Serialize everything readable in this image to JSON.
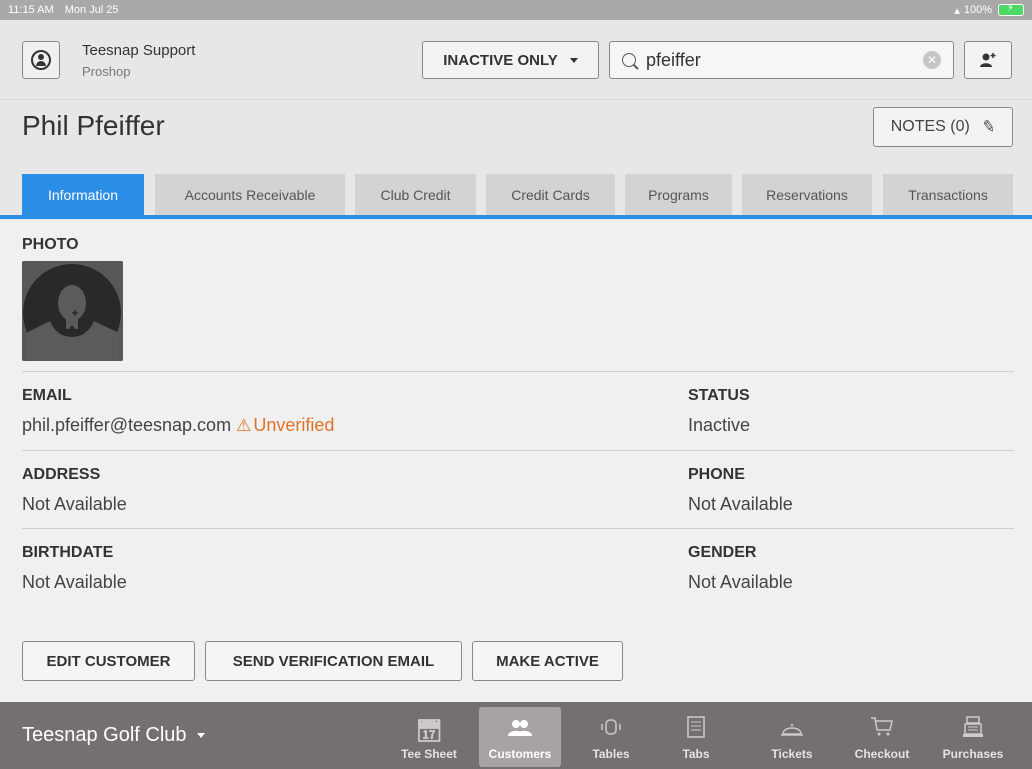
{
  "status_bar": {
    "time": "11:15 AM",
    "date": "Mon Jul 25",
    "battery": "100%"
  },
  "header": {
    "user_name": "Teesnap Support",
    "user_role": "Proshop",
    "filter_label": "INACTIVE ONLY",
    "search_value": "pfeiffer"
  },
  "customer": {
    "name": "Phil Pfeiffer",
    "notes_label": "NOTES (0)"
  },
  "tabs": [
    {
      "label": "Information",
      "active": true
    },
    {
      "label": "Accounts Receivable"
    },
    {
      "label": "Club Credit"
    },
    {
      "label": "Credit Cards"
    },
    {
      "label": "Programs"
    },
    {
      "label": "Reservations"
    },
    {
      "label": "Transactions"
    }
  ],
  "info": {
    "photo_label": "PHOTO",
    "email_label": "EMAIL",
    "email_value": "phil.pfeiffer@teesnap.com",
    "email_status": "Unverified",
    "status_label": "STATUS",
    "status_value": "Inactive",
    "address_label": "ADDRESS",
    "address_value": "Not Available",
    "phone_label": "PHONE",
    "phone_value": "Not Available",
    "birthdate_label": "BIRTHDATE",
    "birthdate_value": "Not Available",
    "gender_label": "GENDER",
    "gender_value": "Not Available"
  },
  "actions": {
    "edit": "EDIT CUSTOMER",
    "send_verification": "SEND VERIFICATION EMAIL",
    "make_active": "MAKE ACTIVE"
  },
  "bottom_bar": {
    "club_name": "Teesnap Golf Club",
    "nav": [
      {
        "label": "Tee Sheet",
        "icon": "calendar-icon"
      },
      {
        "label": "Customers",
        "icon": "customers-icon",
        "active": true
      },
      {
        "label": "Tables",
        "icon": "tables-icon"
      },
      {
        "label": "Tabs",
        "icon": "tabs-icon"
      },
      {
        "label": "Tickets",
        "icon": "bell-icon"
      },
      {
        "label": "Checkout",
        "icon": "cart-icon"
      },
      {
        "label": "Purchases",
        "icon": "register-icon"
      }
    ]
  },
  "colors": {
    "accent": "#2a8ee6",
    "warning": "#e0732a",
    "bottom_bar": "#75706f"
  }
}
